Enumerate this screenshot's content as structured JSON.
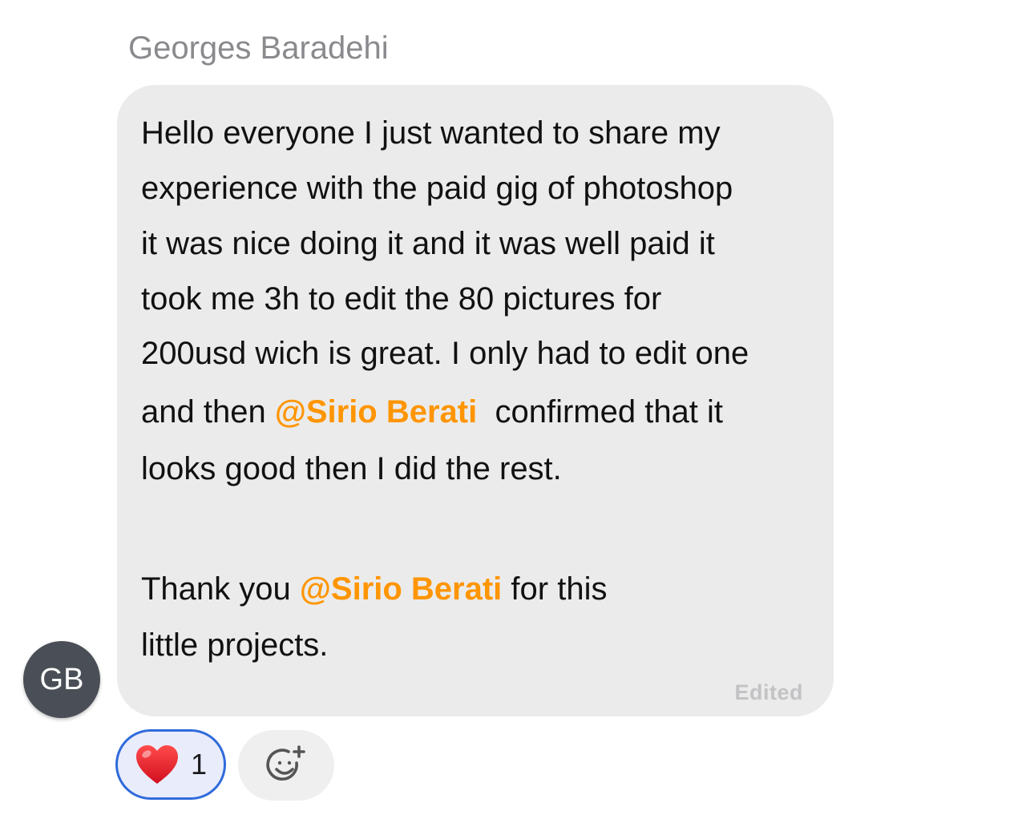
{
  "message": {
    "sender_name": "Georges Baradehi",
    "avatar_initials": "GB",
    "lines": {
      "l1": "Hello everyone I just wanted to share my",
      "l2": "experience with the paid gig of photoshop",
      "l3": "it was nice doing it and it was well paid it",
      "l4": "took me 3h to edit the 80 pictures for",
      "l5": "200usd wich is great. I only had to edit one",
      "l6_pre": "and then ",
      "l6_mention": "@Sirio Berati",
      "l6_post": "  confirmed that it",
      "l7": "looks good then I did the rest.",
      "l8_pre": "Thank you ",
      "l8_mention": "@Sirio Berati",
      "l8_post": " for this",
      "l9": "little projects."
    },
    "edited_label": "Edited"
  },
  "reactions": {
    "heart": {
      "emoji": "heart-icon",
      "count": "1"
    },
    "add_reaction_icon": "add-reaction-icon"
  },
  "colors": {
    "mention": "#ff9500",
    "bubble_bg": "#ebebeb",
    "reaction_border": "#2f6bdb",
    "avatar_bg": "#4a4f57"
  }
}
